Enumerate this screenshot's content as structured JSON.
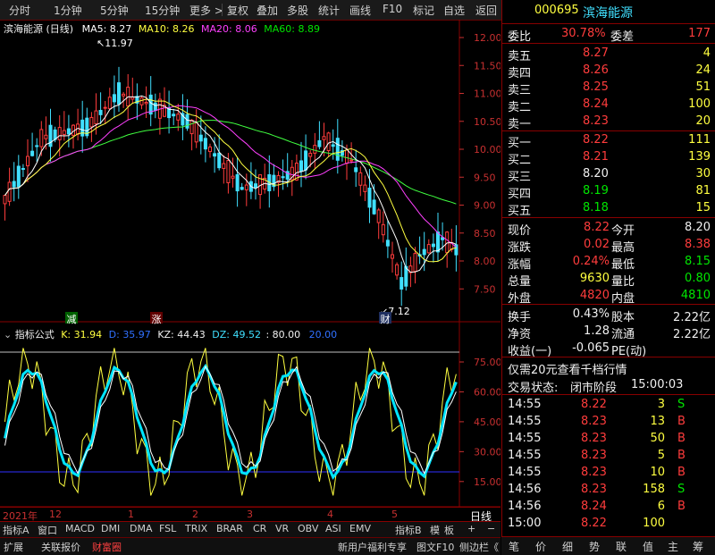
{
  "toolbar": {
    "items": [
      "分时",
      "1分钟",
      "5分钟",
      "15分钟",
      "更多 >",
      "复权",
      "叠加",
      "多股",
      "统计",
      "画线",
      "F10",
      "标记",
      "自选",
      "返回"
    ]
  },
  "main_panel": {
    "title": "滨海能源 (日线)",
    "ma5": "MA5: 8.27",
    "ma10": "MA10: 8.26",
    "ma20": "MA20: 8.06",
    "ma60": "MA60: 8.89",
    "high_marker": "11.97",
    "low_marker": "7.12",
    "y_ticks": [
      "12.00",
      "11.50",
      "11.00",
      "10.50",
      "10.00",
      "9.50",
      "9.00",
      "8.50",
      "8.00",
      "7.50"
    ],
    "tags": {
      "jian": "减",
      "zhang": "涨",
      "cai": "财"
    }
  },
  "indicator_panel": {
    "title": "指标公式",
    "k": "K: 31.94",
    "d": "D: 35.97",
    "kz": "KZ: 44.43",
    "dz": "DZ: 49.52",
    "line80": ": 80.00",
    "line20": "20.00",
    "y_ticks": [
      "75.00",
      "60.00",
      "45.00",
      "30.00",
      "15.00"
    ]
  },
  "date_axis": {
    "labels": [
      "2021年",
      "12",
      "1",
      "2",
      "3",
      "4",
      "5"
    ],
    "right_label": "日线"
  },
  "tabs_row1": [
    "指标A",
    "窗口",
    "MACD",
    "DMI",
    "DMA",
    "FSL",
    "TRIX",
    "BRAR",
    "CR",
    "VR",
    "OBV",
    "ASI",
    "EMV",
    "指标B",
    "模",
    "板",
    "+",
    "−"
  ],
  "tabs_row2": [
    "扩展",
    "关联报价",
    "财富圈",
    "新用户福利专享",
    "图文F10",
    "侧边栏《"
  ],
  "stock": {
    "code": "000695",
    "name": "滨海能源"
  },
  "quote": {
    "weibi_label": "委比",
    "weibi": "30.78%",
    "weicha_label": "委差",
    "weicha": "177",
    "asks": [
      {
        "label": "卖五",
        "price": "8.27",
        "vol": "4"
      },
      {
        "label": "卖四",
        "price": "8.26",
        "vol": "24"
      },
      {
        "label": "卖三",
        "price": "8.25",
        "vol": "51"
      },
      {
        "label": "卖二",
        "price": "8.24",
        "vol": "100"
      },
      {
        "label": "卖一",
        "price": "8.23",
        "vol": "20"
      }
    ],
    "bids": [
      {
        "label": "买一",
        "price": "8.22",
        "vol": "111",
        "color": "red"
      },
      {
        "label": "买二",
        "price": "8.21",
        "vol": "139",
        "color": "red"
      },
      {
        "label": "买三",
        "price": "8.20",
        "vol": "30",
        "color": "wht"
      },
      {
        "label": "买四",
        "price": "8.19",
        "vol": "81",
        "color": "grn"
      },
      {
        "label": "买五",
        "price": "8.18",
        "vol": "15",
        "color": "grn"
      }
    ],
    "stats": [
      {
        "l1": "现价",
        "v1": "8.22",
        "c1": "red",
        "l2": "今开",
        "v2": "8.20",
        "c2": "wht"
      },
      {
        "l1": "涨跌",
        "v1": "0.02",
        "c1": "red",
        "l2": "最高",
        "v2": "8.38",
        "c2": "red"
      },
      {
        "l1": "涨幅",
        "v1": "0.24%",
        "c1": "red",
        "l2": "最低",
        "v2": "8.15",
        "c2": "grn"
      },
      {
        "l1": "总量",
        "v1": "9630",
        "c1": "yel",
        "l2": "量比",
        "v2": "0.80",
        "c2": "grn"
      },
      {
        "l1": "外盘",
        "v1": "4820",
        "c1": "red",
        "l2": "内盘",
        "v2": "4810",
        "c2": "grn"
      }
    ],
    "stats2": [
      {
        "l1": "换手",
        "v1": "0.43%",
        "l2": "股本",
        "v2": "2.22亿"
      },
      {
        "l1": "净资",
        "v1": "1.28",
        "l2": "流通",
        "v2": "2.22亿"
      },
      {
        "l1": "收益(一)",
        "v1": "-0.065",
        "l2": "PE(动)",
        "v2": ""
      }
    ],
    "promo": "仅需20元查看千档行情",
    "status_label": "交易状态:",
    "status": "闭市阶段",
    "status_time": "15:00:03"
  },
  "ticks": [
    {
      "t": "14:55",
      "p": "8.22",
      "v": "3",
      "s": "S"
    },
    {
      "t": "14:55",
      "p": "8.23",
      "v": "13",
      "s": "B"
    },
    {
      "t": "14:55",
      "p": "8.23",
      "v": "50",
      "s": "B"
    },
    {
      "t": "14:55",
      "p": "8.23",
      "v": "5",
      "s": "B"
    },
    {
      "t": "14:55",
      "p": "8.23",
      "v": "10",
      "s": "B"
    },
    {
      "t": "14:56",
      "p": "8.23",
      "v": "158",
      "s": "S"
    },
    {
      "t": "14:56",
      "p": "8.24",
      "v": "6",
      "s": "B"
    },
    {
      "t": "15:00",
      "p": "8.22",
      "v": "100",
      "s": ""
    }
  ],
  "right_tabs": [
    "笔",
    "价",
    "细",
    "势",
    "联",
    "值",
    "主",
    "筹"
  ],
  "colors": {
    "up": "#ff3c3c",
    "down": "#00e600",
    "ma5": "#ffffff",
    "ma10": "#ffff40",
    "ma20": "#ff40ff",
    "ma60": "#40ff40",
    "bg": "#000000",
    "border": "#800000"
  }
}
